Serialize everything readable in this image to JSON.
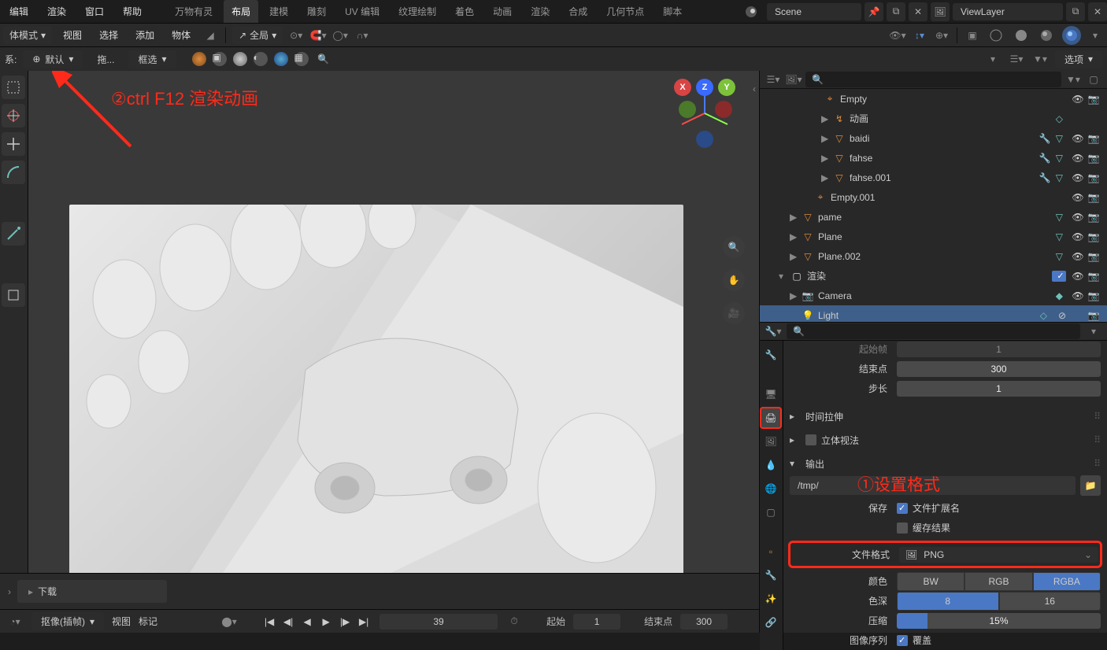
{
  "topmenu": {
    "edit": "编辑",
    "render": "渲染",
    "window": "窗口",
    "help": "帮助"
  },
  "workspaces": {
    "wanwu": "万物有灵",
    "layout": "布局",
    "modeling": "建模",
    "sculpt": "雕刻",
    "uv": "UV 编辑",
    "texpaint": "纹理绘制",
    "shading": "着色",
    "anim": "动画",
    "render": "渲染",
    "comp": "合成",
    "geo": "几何节点",
    "script": "脚本"
  },
  "scene": {
    "name": "Scene",
    "layer": "ViewLayer"
  },
  "toolbar2": {
    "mode": "体模式",
    "view": "视图",
    "select": "选择",
    "add": "添加",
    "object": "物体",
    "global_lbl": "全局"
  },
  "toolbar3": {
    "rel": "系:",
    "default": "默认",
    "drag": "拖...",
    "boxsel": "框选",
    "options": "选项"
  },
  "annotation": {
    "step2": "②ctrl F12 渲染动画",
    "step1": "①设置格式"
  },
  "outliner": {
    "items": [
      {
        "indent": 28,
        "tri": "",
        "ic": "⌖",
        "cls": "empty-ic",
        "name": "Empty",
        "mods": [],
        "eye": true,
        "cam": true
      },
      {
        "indent": 40,
        "tri": "▶",
        "ic": "↯",
        "cls": "empty-ic",
        "name": "动画",
        "mods": [
          "◇"
        ],
        "eye": false,
        "cam": false
      },
      {
        "indent": 40,
        "tri": "▶",
        "ic": "▽",
        "cls": "mesh-ic",
        "name": "baidi",
        "mods": [
          "🔧",
          "▽"
        ],
        "eye": true,
        "cam": true
      },
      {
        "indent": 40,
        "tri": "▶",
        "ic": "▽",
        "cls": "mesh-ic",
        "name": "fahse",
        "mods": [
          "🔧",
          "▽"
        ],
        "eye": true,
        "cam": true
      },
      {
        "indent": 40,
        "tri": "▶",
        "ic": "▽",
        "cls": "mesh-ic",
        "name": "fahse.001",
        "mods": [
          "🔧",
          "▽"
        ],
        "eye": true,
        "cam": true
      },
      {
        "indent": 16,
        "tri": "",
        "ic": "⌖",
        "cls": "empty-ic",
        "name": "Empty.001",
        "mods": [],
        "eye": true,
        "cam": true
      },
      {
        "indent": 0,
        "tri": "▶",
        "ic": "▽",
        "cls": "mesh-ic",
        "name": "pame",
        "mods": [
          "▽"
        ],
        "eye": true,
        "cam": true
      },
      {
        "indent": 0,
        "tri": "▶",
        "ic": "▽",
        "cls": "mesh-ic",
        "name": "Plane",
        "mods": [
          "▽"
        ],
        "eye": true,
        "cam": true
      },
      {
        "indent": 0,
        "tri": "▶",
        "ic": "▽",
        "cls": "mesh-ic",
        "name": "Plane.002",
        "mods": [
          "▽"
        ],
        "eye": true,
        "cam": true
      },
      {
        "indent": -14,
        "tri": "▾",
        "ic": "▢",
        "cls": "coll-ic",
        "name": "渲染",
        "mods": [],
        "eye": true,
        "cam": true,
        "cb": true
      },
      {
        "indent": 0,
        "tri": "▶",
        "ic": "📷",
        "cls": "cam-ic",
        "name": "Camera",
        "mods": [
          "◆"
        ],
        "eye": true,
        "cam": true
      },
      {
        "indent": 0,
        "tri": "",
        "ic": "💡",
        "cls": "cam-ic",
        "name": "Light",
        "mods": [
          "◇"
        ],
        "eye": false,
        "cam": true,
        "selected": true
      }
    ]
  },
  "props": {
    "frame_end_lbl": "结束点",
    "frame_end": "300",
    "step_lbl": "步长",
    "step": "1",
    "truncated_lbl": "起始帧",
    "time_stretch": "时间拉伸",
    "stereo": "立体视法",
    "output": "输出",
    "output_path": "/tmp/",
    "save_lbl": "保存",
    "ext_lbl": "文件扩展名",
    "cache_lbl": "缓存结果",
    "file_format_lbl": "文件格式",
    "file_format": "PNG",
    "color_lbl": "颜色",
    "bw": "BW",
    "rgb": "RGB",
    "rgba": "RGBA",
    "depth_lbl": "色深",
    "depth8": "8",
    "depth16": "16",
    "compress_lbl": "压缩",
    "compress": "15%",
    "seq_lbl": "图像序列",
    "overwrite_lbl": "覆盖"
  },
  "vp_footer": {
    "download": "下载"
  },
  "timeline": {
    "dope": "抠像(插帧)",
    "view": "视图",
    "marker": "标记",
    "frame": "39",
    "start_lbl": "起始",
    "start": "1",
    "end_lbl": "结束点",
    "end": "300"
  }
}
